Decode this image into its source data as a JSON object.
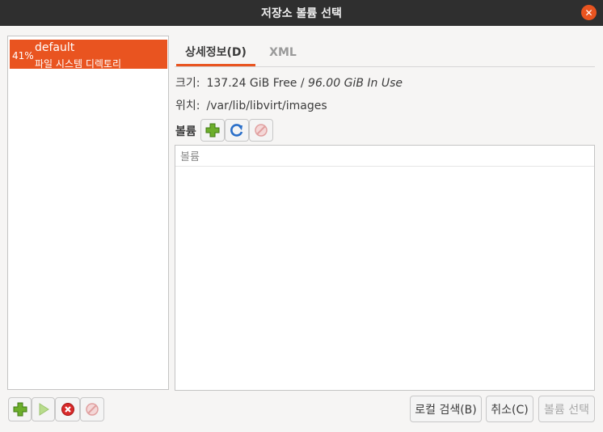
{
  "window": {
    "title": "저장소 볼륨 선택"
  },
  "pools": [
    {
      "percent": "41%",
      "name": "default",
      "type": "파일 시스템 디렉토리"
    }
  ],
  "tabs": [
    {
      "label": "상세정보(D)",
      "active": true
    },
    {
      "label": "XML",
      "active": false
    }
  ],
  "details": {
    "size_label": "크기:",
    "size_free": "137.24 GiB Free / ",
    "size_in_use": "96.00 GiB In Use",
    "location_label": "위치:",
    "location_value": "/var/lib/libvirt/images"
  },
  "volumes": {
    "label": "볼륨",
    "column_header": "볼륨",
    "items": []
  },
  "buttons": {
    "browse_local": "로컬 검색(B)",
    "cancel": "취소(C)",
    "choose_volume": "볼륨 선택"
  },
  "icons": {
    "add": "plus-icon",
    "refresh": "refresh-icon",
    "delete": "delete-icon",
    "start": "play-icon",
    "stop": "stop-icon"
  },
  "colors": {
    "accent": "#e95420",
    "titlebar": "#2f2f2f",
    "add_green": "#6cae2b"
  }
}
